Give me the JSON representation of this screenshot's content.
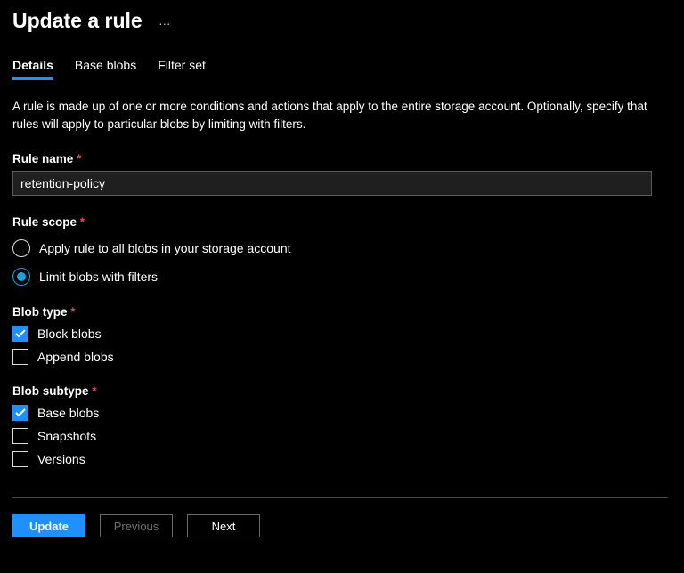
{
  "header": {
    "title": "Update a rule",
    "more_icon": "…"
  },
  "tabs": [
    {
      "label": "Details",
      "active": true
    },
    {
      "label": "Base blobs",
      "active": false
    },
    {
      "label": "Filter set",
      "active": false
    }
  ],
  "description": "A rule is made up of one or more conditions and actions that apply to the entire storage account. Optionally, specify that rules will apply to particular blobs by limiting with filters.",
  "rule_name": {
    "label": "Rule name",
    "value": "retention-policy"
  },
  "rule_scope": {
    "label": "Rule scope",
    "options": [
      {
        "label": "Apply rule to all blobs in your storage account",
        "selected": false
      },
      {
        "label": "Limit blobs with filters",
        "selected": true
      }
    ]
  },
  "blob_type": {
    "label": "Blob type",
    "options": [
      {
        "label": "Block blobs",
        "checked": true
      },
      {
        "label": "Append blobs",
        "checked": false
      }
    ]
  },
  "blob_subtype": {
    "label": "Blob subtype",
    "options": [
      {
        "label": "Base blobs",
        "checked": true
      },
      {
        "label": "Snapshots",
        "checked": false
      },
      {
        "label": "Versions",
        "checked": false
      }
    ]
  },
  "buttons": {
    "update": "Update",
    "previous": "Previous",
    "next": "Next"
  },
  "colors": {
    "accent": "#1e90ff",
    "required": "#e74856"
  }
}
